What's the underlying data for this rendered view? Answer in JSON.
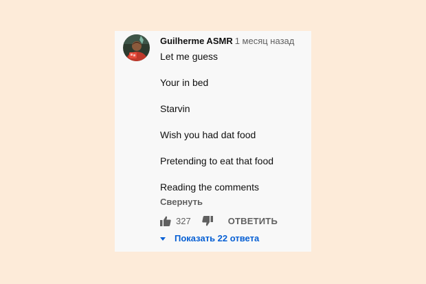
{
  "comment": {
    "author": "Guilherme ASMR",
    "timestamp": "1 месяц назад",
    "avatar_icon": "user-avatar-photo",
    "lines": [
      "Let me guess",
      "Your in bed",
      "Starvin",
      "Wish you had dat food",
      "Pretending to eat that food",
      "Reading the comments"
    ],
    "collapse_label": "Свернуть",
    "like_icon": "thumbs-up-icon",
    "like_count": "327",
    "dislike_icon": "thumbs-down-icon",
    "reply_label": "ОТВЕТИТЬ",
    "replies_label": "Показать 22 ответа"
  },
  "colors": {
    "page_background": "#fdebd9",
    "card_background": "#f8f8f8",
    "link_blue": "#065fd4",
    "secondary_text": "#606060"
  }
}
